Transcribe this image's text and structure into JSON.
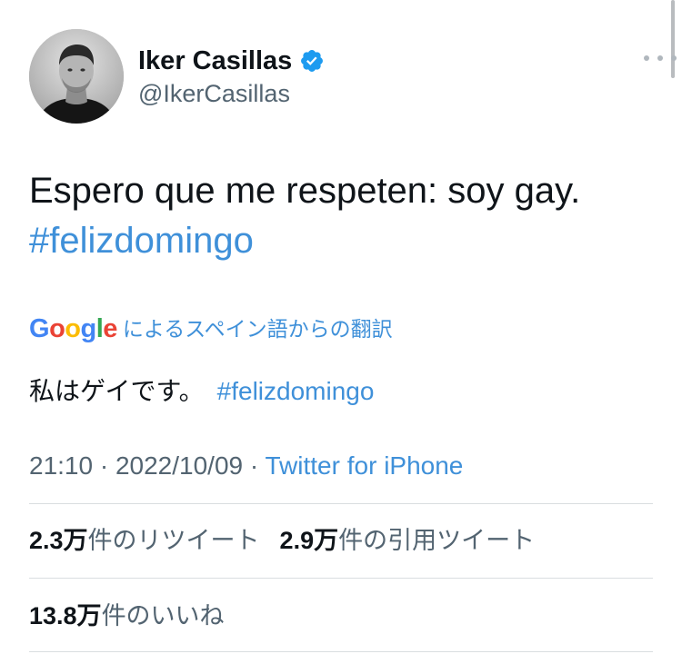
{
  "author": {
    "display_name": "Iker Casillas",
    "handle": "@IkerCasillas",
    "verified": true,
    "avatar_icon": "profile-photo"
  },
  "tweet": {
    "text_line1": "Espero que me respeten: soy gay.",
    "hashtag": "#felizdomingo"
  },
  "translation": {
    "provider_logo_letters": [
      "G",
      "o",
      "o",
      "g",
      "l",
      "e"
    ],
    "label": "によるスペイン語からの翻訳",
    "text": "私はゲイです。",
    "hashtag": "#felizdomingo"
  },
  "meta": {
    "time": "21:10",
    "separator1": " · ",
    "date": "2022/10/09",
    "separator2": " · ",
    "source": "Twitter for iPhone"
  },
  "stats": {
    "retweets_count": "2.3万",
    "retweets_label": "件のリツイート",
    "quotes_count": "2.9万",
    "quotes_label": "件の引用ツイート",
    "likes_count": "13.8万",
    "likes_label": "件のいいね"
  },
  "colors": {
    "link_blue": "#3f90d9",
    "verified_blue": "#1d9bf0",
    "secondary_text": "#536471",
    "primary_text": "#0f1419"
  }
}
